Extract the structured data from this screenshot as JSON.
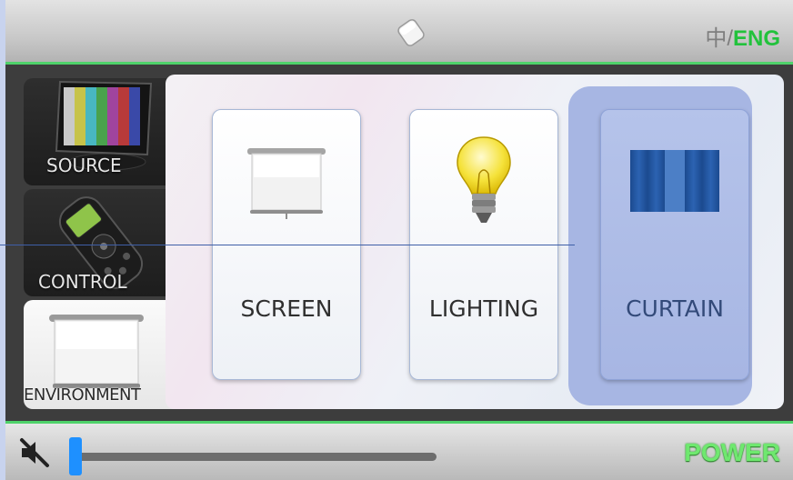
{
  "header": {
    "lang_zh": "中",
    "lang_sep": "/",
    "lang_en": "ENG",
    "icon": "glass-button-icon"
  },
  "sidebar": {
    "items": [
      {
        "label": "SOURCE",
        "icon": "tv-color-bars-icon",
        "selected": false
      },
      {
        "label": "CONTROL",
        "icon": "remote-control-icon",
        "selected": false
      },
      {
        "label": "ENVIRONMENT",
        "icon": "projection-screen-icon",
        "selected": true
      }
    ]
  },
  "tiles": [
    {
      "label": "SCREEN",
      "icon": "projection-screen-icon",
      "selected": false
    },
    {
      "label": "LIGHTING",
      "icon": "light-bulb-icon",
      "selected": false
    },
    {
      "label": "CURTAIN",
      "icon": "curtain-icon",
      "selected": true
    }
  ],
  "footer": {
    "mute_icon": "speaker-muted-icon",
    "volume_fraction": 0.0,
    "power_label": "POWER"
  },
  "colors": {
    "accent_green": "#4fd26a",
    "selected_blue": "#a7b6e3",
    "slider_thumb": "#1e90ff"
  }
}
